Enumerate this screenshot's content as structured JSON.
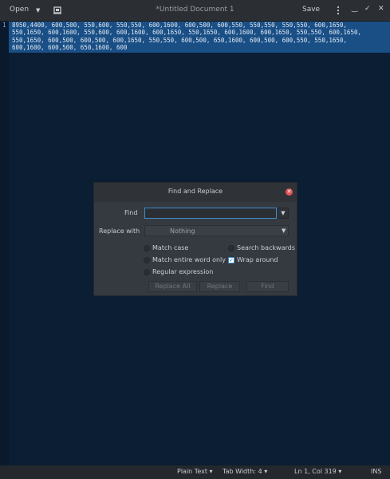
{
  "header": {
    "open_label": "Open",
    "open_arrow": "▼",
    "title": "*Untitled Document 1",
    "save_label": "Save",
    "minimize": "‿",
    "maximize": "✓",
    "close": "✕"
  },
  "editor": {
    "line_number": "1",
    "text_lines": [
      "8950,4400, 600,500, 550,600, 550,550, 600,1600, 600,500, 600,550, 550,550, 550,550, 600,1650,",
      "550,1650, 600,1600, 550,600, 600,1600, 600,1650, 550,1650, 600,1600, 600,1650, 550,550, 600,1650,",
      "550,1650, 600,500, 600,500, 600,1650, 550,550, 600,500, 650,1600, 600,500, 600,550, 550,1650,",
      "600,1600, 600,500, 650,1600, 600"
    ]
  },
  "dialog": {
    "title": "Find and Replace",
    "close": "✕",
    "find_label": "Find",
    "find_value": "",
    "replace_label": "Replace with",
    "replace_value": "Nothing",
    "dropdown_arrow": "▼",
    "options": {
      "match_case": "Match case",
      "search_backwards": "Search backwards",
      "match_word": "Match entire word only",
      "wrap_around": "Wrap around",
      "regex": "Regular expression"
    },
    "wrap_around_check": "✓",
    "buttons": {
      "replace_all": "Replace All",
      "replace": "Replace",
      "find": "Find"
    }
  },
  "statusbar": {
    "language": "Plain Text ▾",
    "tab_width": "Tab Width: 4 ▾",
    "position": "Ln 1, Col 319 ▾",
    "mode": "INS"
  }
}
